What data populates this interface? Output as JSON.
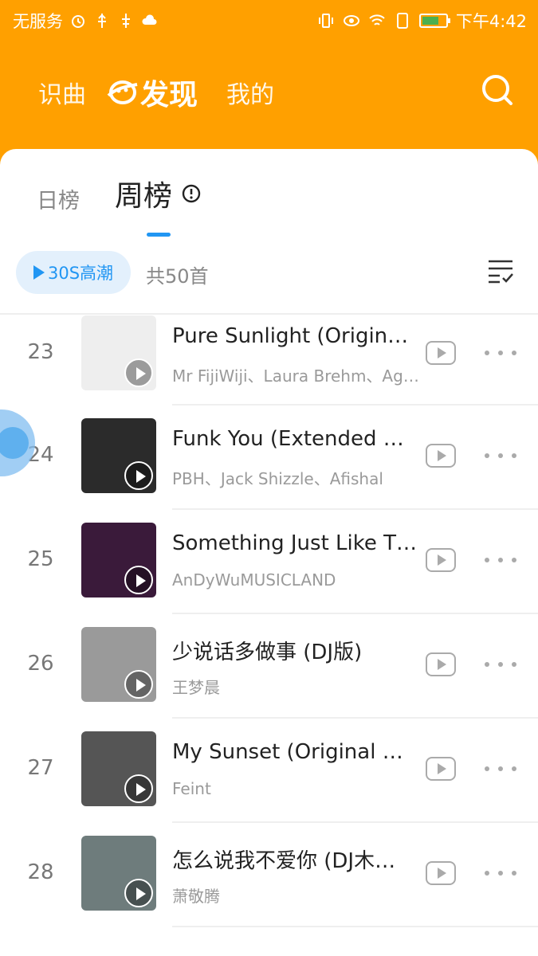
{
  "status_bar": {
    "carrier": "无服务",
    "time": "下午4:42"
  },
  "header": {
    "tabs": [
      "识曲",
      "发现",
      "我的"
    ],
    "active_tab": "发现"
  },
  "chart": {
    "tabs": [
      "日榜",
      "周榜"
    ],
    "active_tab": "周榜",
    "play_highlight_label": "30S高潮",
    "count_label": "共50首"
  },
  "songs": [
    {
      "rank": "23",
      "title": "Pure Sunlight (Original…",
      "artist": "Mr FijiWiji、Laura Brehm、Ag…",
      "cover_color": "#eeeeee"
    },
    {
      "rank": "24",
      "title": "Funk You (Extended Mix)",
      "artist": "PBH、Jack Shizzle、Afishal",
      "cover_color": "#2b2b2b"
    },
    {
      "rank": "25",
      "title": "Something Just Like Th…",
      "artist": "AnDyWuMUSICLAND",
      "cover_color": "#3a1a3a"
    },
    {
      "rank": "26",
      "title": "少说话多做事 (DJ版)",
      "artist": "王梦晨",
      "cover_color": "#9a9a9a"
    },
    {
      "rank": "27",
      "title": "My Sunset (Original Mix)",
      "artist": "Feint",
      "cover_color": "#555555"
    },
    {
      "rank": "28",
      "title": "怎么说我不爱你 (DJ木…",
      "artist": "萧敬腾",
      "cover_color": "#6e7c7c"
    }
  ],
  "colors": {
    "brand": "#ffa000",
    "accent": "#2196f3"
  }
}
